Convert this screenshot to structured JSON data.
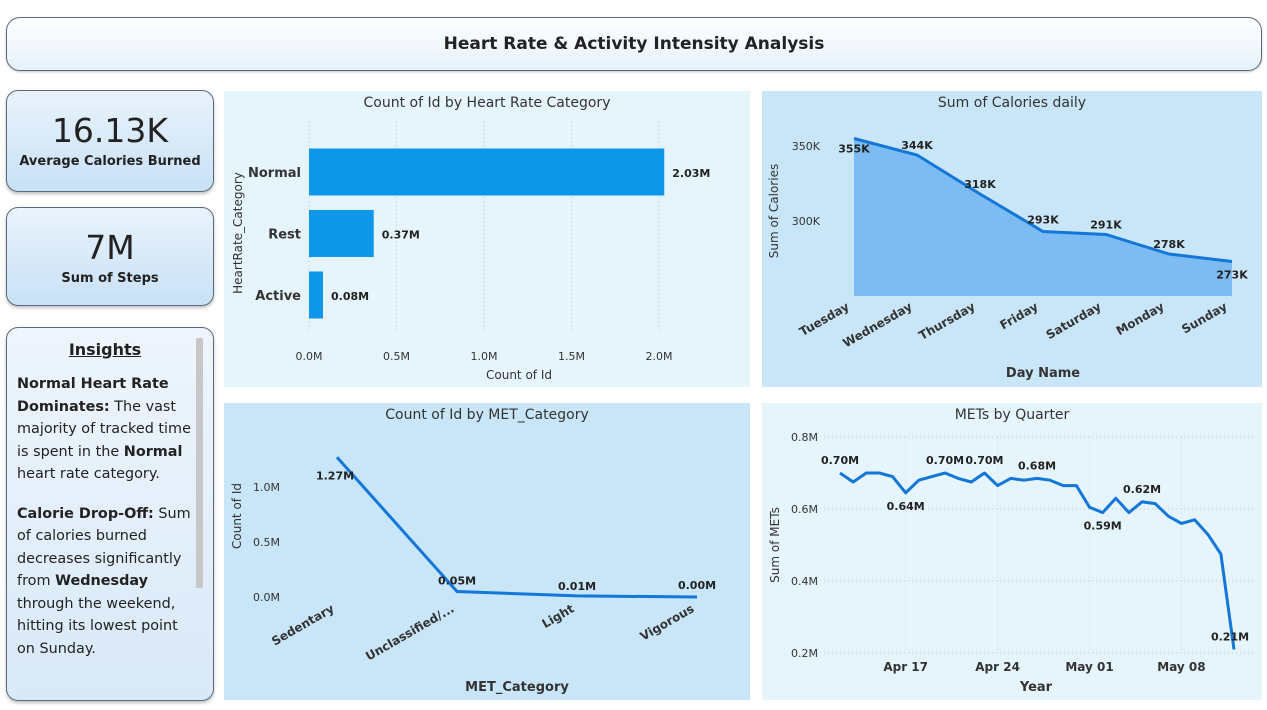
{
  "header": {
    "title": "Heart Rate & Activity Intensity Analysis"
  },
  "kpis": [
    {
      "value": "16.13K",
      "label": "Average Calories Burned"
    },
    {
      "value": "7M",
      "label": "Sum of Steps"
    }
  ],
  "insights": {
    "title": "Insights",
    "p1_bold": "Normal Heart Rate Dominates:",
    "p1_text1": " The vast majority of tracked time is spent in the ",
    "p1_bold2": "Normal",
    "p1_text2": " heart rate category.",
    "p2_bold": "Calorie Drop-Off:",
    "p2_text1": " Sum of calories burned decreases significantly from ",
    "p2_bold2": "Wednesday",
    "p2_text2": " through the weekend, hitting its lowest point on Sunday."
  },
  "colors": {
    "bar": "#0e96e9",
    "line": "#1277d8",
    "area_fill": "#74b7f2",
    "panel_light": "#e6f4fc",
    "panel_mid": "#c9e6f8"
  },
  "chart_data": [
    {
      "type": "bar",
      "title": "Count of Id by Heart Rate Category",
      "xlabel": "Count of Id",
      "ylabel": "HeartRate_Category",
      "categories": [
        "Normal",
        "Rest",
        "Active"
      ],
      "values": [
        2030000,
        370000,
        80000
      ],
      "data_labels": [
        "2.03M",
        "0.37M",
        "0.08M"
      ],
      "xlim": [
        0,
        2200000
      ],
      "xticks": [
        0,
        500000,
        1000000,
        1500000,
        2000000
      ],
      "xtick_labels": [
        "0.0M",
        "0.5M",
        "1.0M",
        "1.5M",
        "2.0M"
      ],
      "grid": true
    },
    {
      "type": "area",
      "title": "Sum of Calories daily",
      "xlabel": "Day Name",
      "ylabel": "Sum of Calories",
      "categories": [
        "Tuesday",
        "Wednesday",
        "Thursday",
        "Friday",
        "Saturday",
        "Monday",
        "Sunday"
      ],
      "values": [
        355000,
        344000,
        318000,
        293000,
        291000,
        278000,
        273000
      ],
      "data_labels": [
        "355K",
        "344K",
        "318K",
        "293K",
        "291K",
        "278K",
        "273K"
      ],
      "ylim": [
        250000,
        360000
      ],
      "yticks": [
        300000,
        350000
      ],
      "ytick_labels": [
        "300K",
        "350K"
      ],
      "grid": false
    },
    {
      "type": "line",
      "title": "Count of Id by MET_Category",
      "xlabel": "MET_Category",
      "ylabel": "Count of Id",
      "categories": [
        "Sedentary",
        "Unclassified/...",
        "Light",
        "Vigorous"
      ],
      "values": [
        1270000,
        50000,
        10000,
        0
      ],
      "data_labels": [
        "1.27M",
        "0.05M",
        "0.01M",
        "0.00M"
      ],
      "ylim": [
        0,
        1400000
      ],
      "yticks": [
        0,
        500000,
        1000000
      ],
      "ytick_labels": [
        "0.0M",
        "0.5M",
        "1.0M"
      ],
      "grid": false
    },
    {
      "type": "line",
      "title": "METs by Quarter",
      "xlabel": "Year",
      "ylabel": "Sum of METs",
      "x": [
        "2016-04-12",
        "2016-04-13",
        "2016-04-14",
        "2016-04-15",
        "2016-04-16",
        "2016-04-17",
        "2016-04-18",
        "2016-04-19",
        "2016-04-20",
        "2016-04-21",
        "2016-04-22",
        "2016-04-23",
        "2016-04-24",
        "2016-04-25",
        "2016-04-26",
        "2016-04-27",
        "2016-04-28",
        "2016-04-29",
        "2016-04-30",
        "2016-05-01",
        "2016-05-02",
        "2016-05-03",
        "2016-05-04",
        "2016-05-05",
        "2016-05-06",
        "2016-05-07",
        "2016-05-08",
        "2016-05-09",
        "2016-05-10",
        "2016-05-11",
        "2016-05-12"
      ],
      "values": [
        0.7,
        0.675,
        0.7,
        0.7,
        0.69,
        0.645,
        0.68,
        0.69,
        0.7,
        0.685,
        0.675,
        0.7,
        0.665,
        0.685,
        0.68,
        0.685,
        0.68,
        0.665,
        0.665,
        0.605,
        0.59,
        0.63,
        0.59,
        0.62,
        0.615,
        0.58,
        0.56,
        0.57,
        0.53,
        0.475,
        0.21
      ],
      "annotations": [
        {
          "x": "2016-04-12",
          "label": "0.70M"
        },
        {
          "x": "2016-04-17",
          "label": "0.64M"
        },
        {
          "x": "2016-04-20",
          "label": "0.70M"
        },
        {
          "x": "2016-04-23",
          "label": "0.70M"
        },
        {
          "x": "2016-04-27",
          "label": "0.68M"
        },
        {
          "x": "2016-05-02",
          "label": "0.59M"
        },
        {
          "x": "2016-05-05",
          "label": "0.62M"
        },
        {
          "x": "2016-05-12",
          "label": "0.21M"
        }
      ],
      "ylim": [
        0.2,
        0.8
      ],
      "yticks": [
        0.2,
        0.4,
        0.6,
        0.8
      ],
      "ytick_labels": [
        "0.2M",
        "0.4M",
        "0.6M",
        "0.8M"
      ],
      "xticks": [
        "2016-04-17",
        "2016-04-24",
        "2016-05-01",
        "2016-05-08"
      ],
      "xtick_labels": [
        "Apr 17",
        "Apr 24",
        "May 01",
        "May 08"
      ],
      "grid": true
    }
  ]
}
